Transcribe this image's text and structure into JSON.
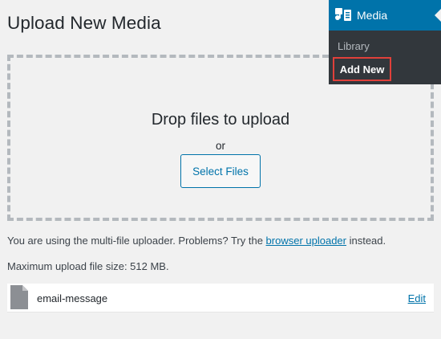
{
  "page": {
    "title": "Upload New Media"
  },
  "dropzone": {
    "title": "Drop files to upload",
    "or_text": "or",
    "select_button": "Select Files"
  },
  "uploader_note": {
    "prefix": "You are using the multi-file uploader. Problems? Try the ",
    "link": "browser uploader",
    "suffix": " instead."
  },
  "max_size": "Maximum upload file size: 512 MB.",
  "media_item": {
    "icon": "document-icon",
    "filename": "email-message",
    "edit_label": "Edit"
  },
  "admin_menu": {
    "header_label": "Media",
    "header_icon": "media-icon",
    "items": [
      {
        "label": "Library"
      },
      {
        "label": "Add New",
        "current": true,
        "highlight_color": "#e0403a"
      }
    ]
  },
  "colors": {
    "accent": "#0073aa",
    "menu_bg": "#32373c",
    "highlight": "#e0403a"
  }
}
